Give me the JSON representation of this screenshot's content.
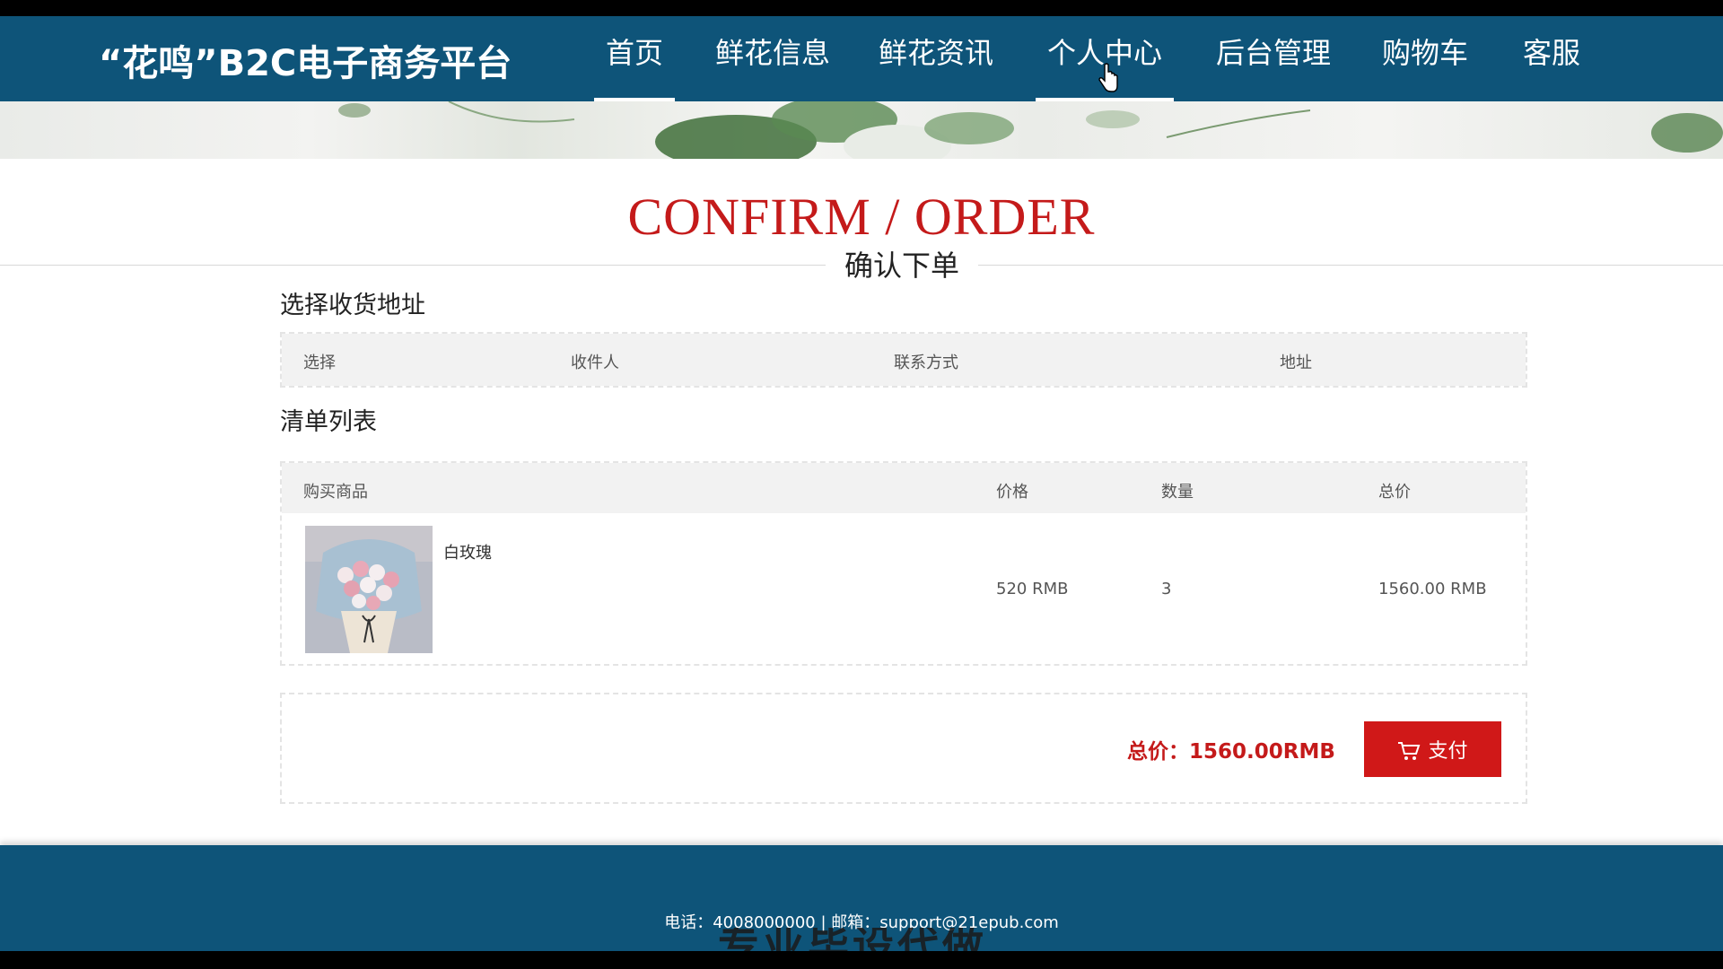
{
  "header": {
    "brand": "“花鸣”B2C电子商务平台",
    "nav": [
      "首页",
      "鲜花信息",
      "鲜花资讯",
      "个人中心",
      "后台管理",
      "购物车",
      "客服"
    ]
  },
  "title": {
    "en": "CONFIRM / ORDER",
    "cn": "确认下单"
  },
  "address": {
    "section_title": "选择收货地址",
    "columns": [
      "选择",
      "收件人",
      "联系方式",
      "地址"
    ]
  },
  "order": {
    "section_title": "清单列表",
    "columns": [
      "购买商品",
      "价格",
      "数量",
      "总价"
    ],
    "items": [
      {
        "name": "白玫瑰",
        "price": "520 RMB",
        "qty": "3",
        "total": "1560.00 RMB"
      }
    ]
  },
  "summary": {
    "label": "总价：",
    "value": "1560.00RMB",
    "pay_label": "支付"
  },
  "footer": {
    "text": "电话：4008000000 | 邮箱：support@21epub.com",
    "overlay": "专业毕设代做"
  },
  "colors": {
    "header": "#0e5479",
    "accent": "#c41a1a",
    "button": "#d01818"
  }
}
